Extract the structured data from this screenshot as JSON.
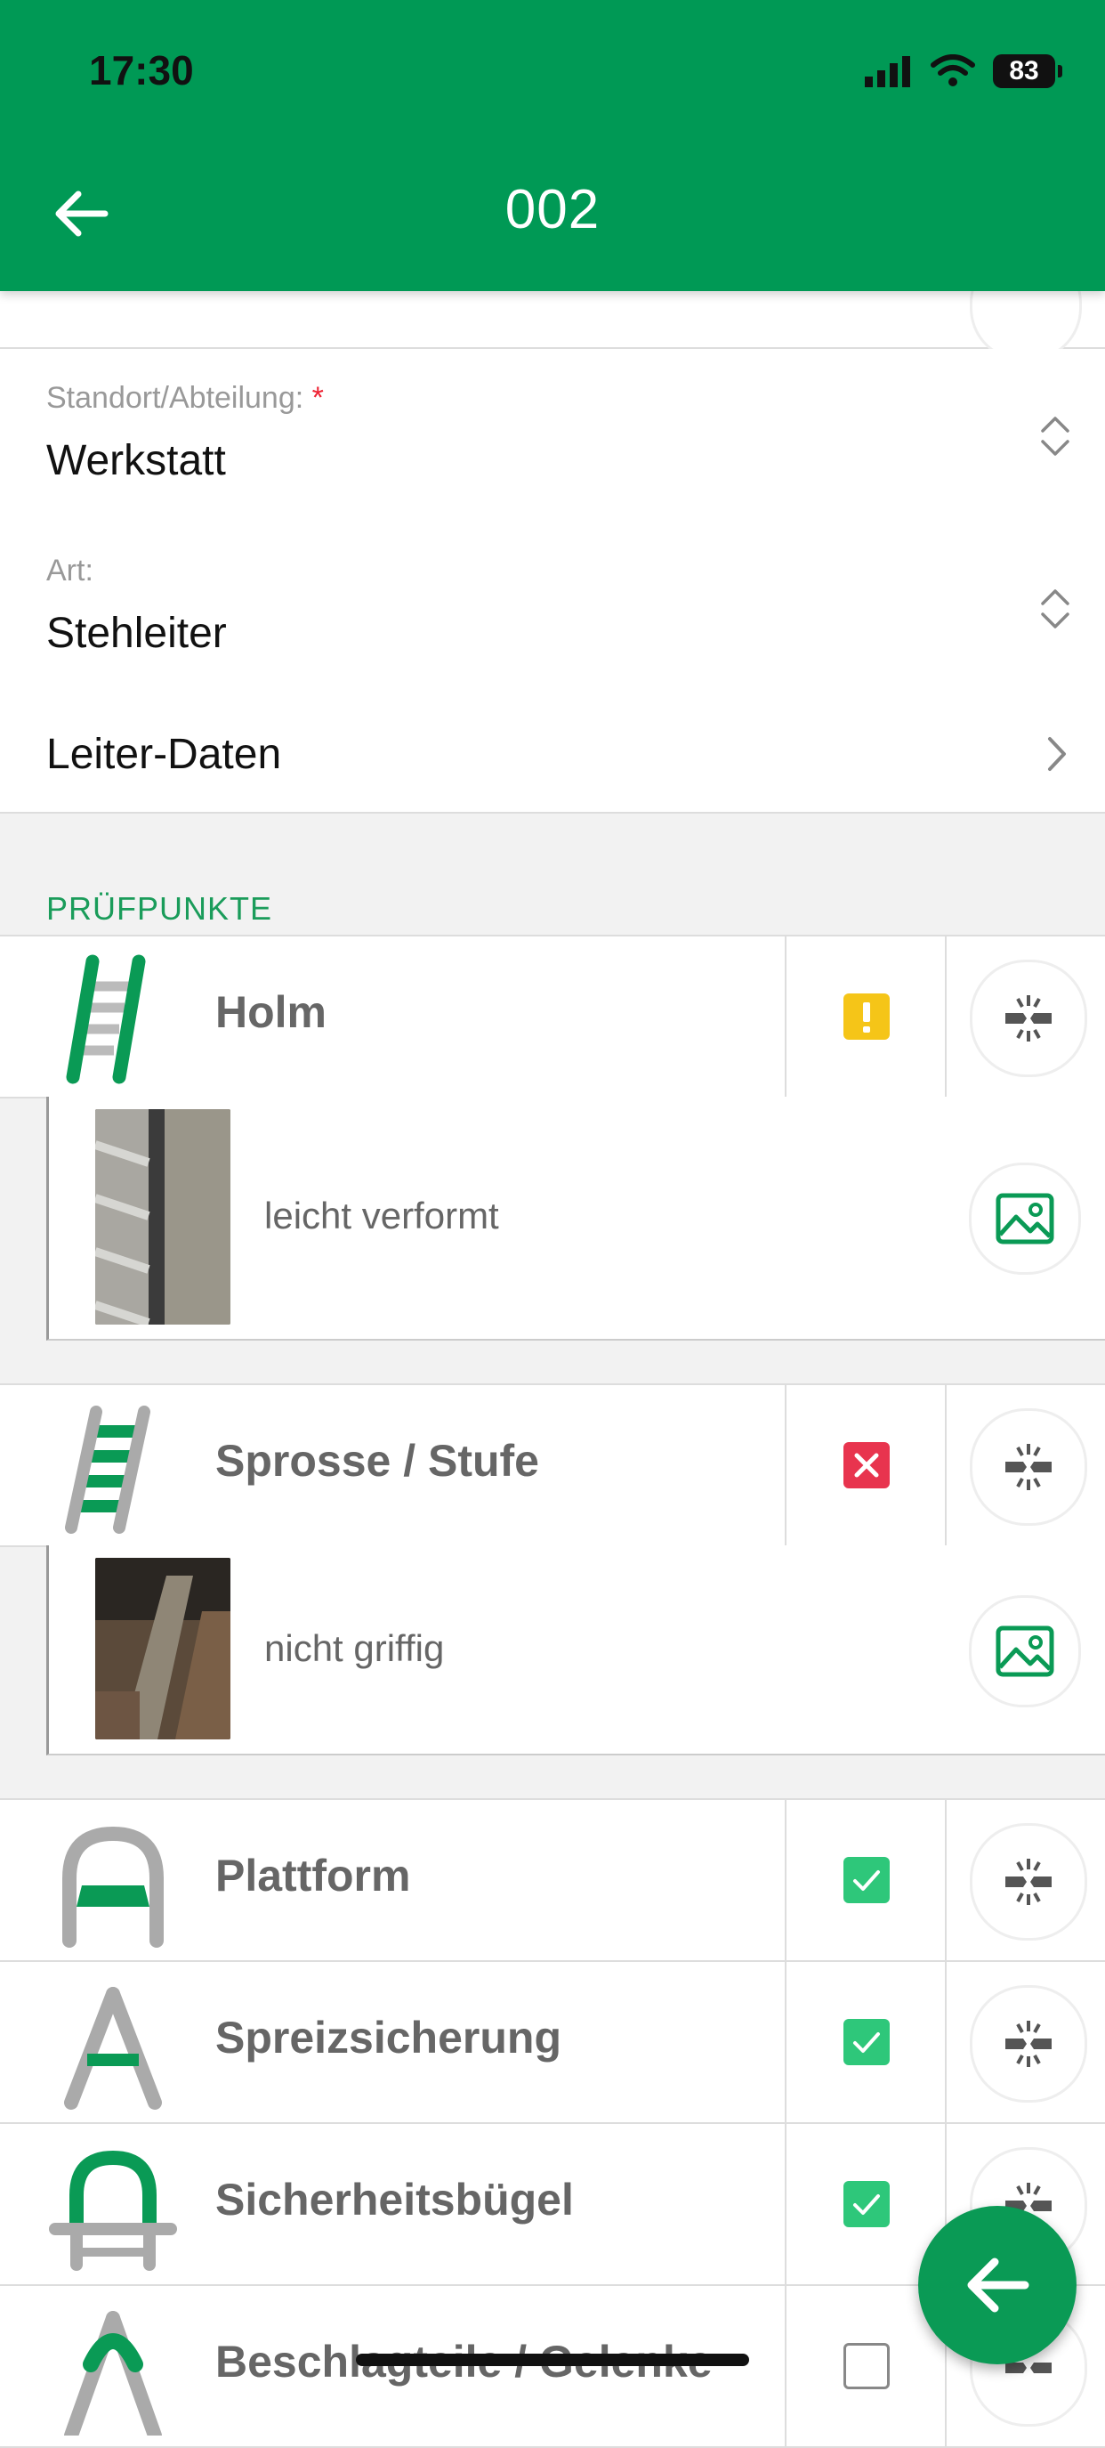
{
  "status_bar": {
    "time": "17:30",
    "battery": "83"
  },
  "header": {
    "title": "002"
  },
  "fields": {
    "location": {
      "label": "Standort/Abteilung:",
      "required_mark": "*",
      "value": "Werkstatt"
    },
    "type": {
      "label": "Art:",
      "value": "Stehleiter"
    },
    "ladder_data": {
      "label": "Leiter-Daten"
    }
  },
  "section": {
    "title": "PRÜFPUNKTE"
  },
  "items": [
    {
      "label": "Holm",
      "status": "warning",
      "icon": "ladder-rails-icon",
      "detail": {
        "text": "leicht verformt"
      }
    },
    {
      "label": "Sprosse / Stufe",
      "status": "failed",
      "icon": "ladder-rungs-icon",
      "detail": {
        "text": "nicht griffig"
      }
    },
    {
      "label": "Plattform",
      "status": "passed",
      "icon": "platform-icon"
    },
    {
      "label": "Spreizsicherung",
      "status": "passed",
      "icon": "spreader-icon"
    },
    {
      "label": "Sicherheitsbügel",
      "status": "passed",
      "icon": "safety-bracket-icon"
    },
    {
      "label": "Beschlagteile / Gelenke",
      "status": "unchecked",
      "icon": "hinge-icon"
    }
  ],
  "colors": {
    "brand": "#009955",
    "warning": "#f5c518",
    "failed": "#e8344e",
    "passed": "#2ec77a"
  }
}
